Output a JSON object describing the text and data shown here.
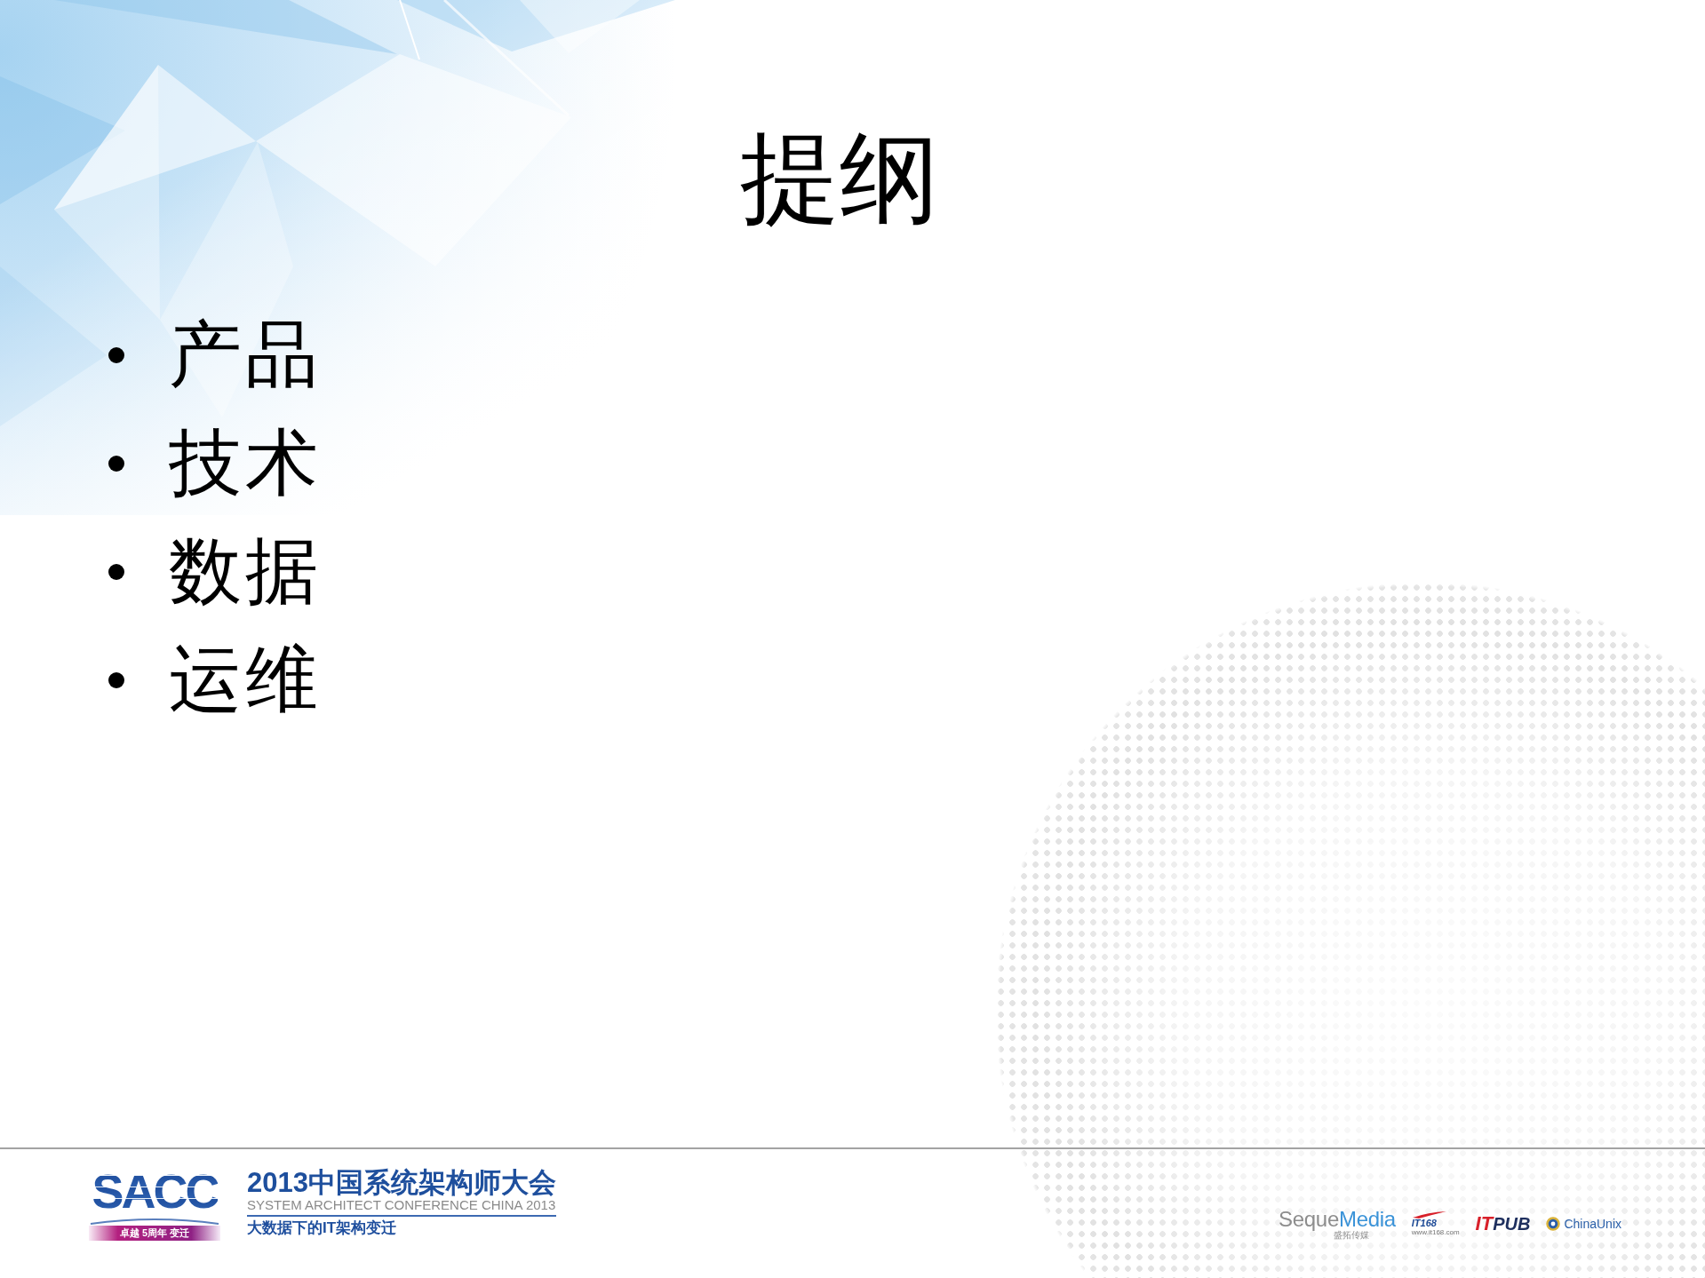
{
  "slide": {
    "title": "提纲",
    "bullets": [
      "产品",
      "技术",
      "数据",
      "运维"
    ]
  },
  "footer": {
    "event_logo": {
      "wordmark": "SACC",
      "badge": "卓越 5周年 变迁"
    },
    "event_name": "2013中国系统架构师大会",
    "event_name_en": "SYSTEM ARCHITECT CONFERENCE CHINA 2013",
    "theme": "大数据下的IT架构变迁",
    "partners": [
      {
        "kind": "wordmark",
        "parts": [
          "Seque",
          "Media"
        ],
        "subtitle": "盛拓传媒"
      },
      {
        "kind": "swoosh",
        "name": "IT168",
        "url": "www.it168.com"
      },
      {
        "kind": "split",
        "parts": [
          "IT",
          "PUB"
        ]
      },
      {
        "kind": "emblem",
        "name": "ChinaUnix"
      }
    ]
  }
}
